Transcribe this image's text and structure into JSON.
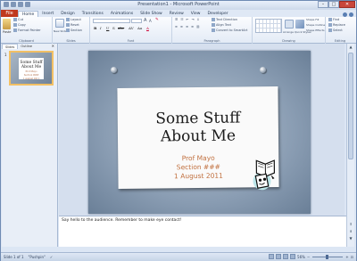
{
  "window": {
    "title": "Presentation1 - Microsoft PowerPoint"
  },
  "tabs": [
    "Home",
    "Insert",
    "Design",
    "Transitions",
    "Animations",
    "Slide Show",
    "Review",
    "View",
    "Developer"
  ],
  "file_tab": "File",
  "active_tab": "Home",
  "ribbon": {
    "groups": [
      "Clipboard",
      "Slides",
      "Font",
      "Paragraph",
      "Drawing",
      "Editing"
    ],
    "paste": "Paste",
    "clipboard_cmds": [
      "Cut",
      "Copy",
      "Format Painter"
    ],
    "new_slide": "New Slide",
    "slides_cmds": [
      "Layout",
      "Reset",
      "Section"
    ],
    "font_buttons": [
      "B",
      "I",
      "U",
      "S",
      "abc",
      "AV",
      "Aa",
      "A"
    ],
    "paragraph_cmds": [
      "Text Direction",
      "Align Text",
      "Convert to SmartArt"
    ],
    "drawing_cmds": [
      "Arrange",
      "Quick Styles",
      "Shape Fill",
      "Shape Outline",
      "Shape Effects"
    ],
    "editing_cmds": [
      "Find",
      "Replace",
      "Select"
    ]
  },
  "left_pane": {
    "tabs": [
      "Slides",
      "Outline"
    ],
    "slide_number": "1",
    "thumb_title": "Some Stuff About Me",
    "thumb_sub": [
      "Prof Mayo",
      "Section ###",
      "1 August 2011"
    ]
  },
  "slide": {
    "title_line1": "Some Stuff",
    "title_line2": "About Me",
    "subtitle": [
      "Prof Mayo",
      "Section ###",
      "1 August 2011"
    ]
  },
  "notes": "Say hello to the audience. Remember to make eye contact!",
  "status": {
    "slide_info": "Slide 1 of 1",
    "theme": "\"Pushpin\"",
    "zoom": "56%"
  },
  "colors": {
    "file_tab": "#c0381e",
    "subtitle": "#c1703f",
    "accent": "#5a7fb3"
  }
}
